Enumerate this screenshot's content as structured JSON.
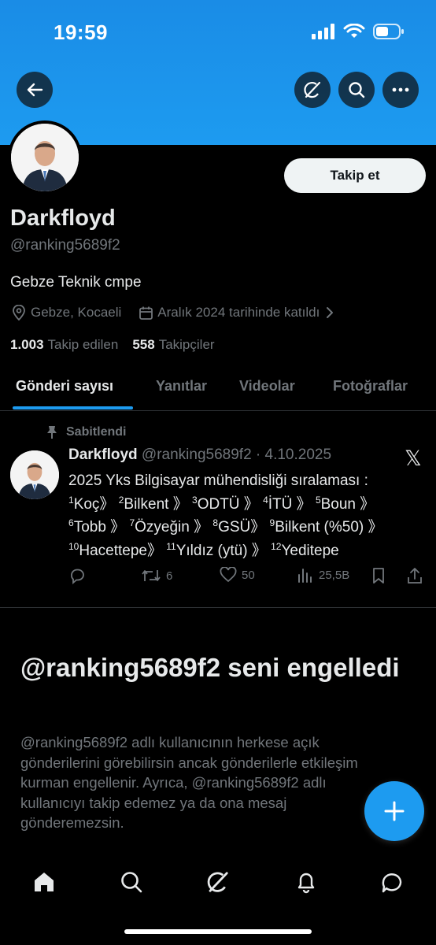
{
  "status_bar": {
    "time": "19:59"
  },
  "header": {
    "back_icon": "arrow-left-icon",
    "grok_icon": "grok-icon",
    "search_icon": "search-icon",
    "more_icon": "more-horizontal-icon"
  },
  "profile": {
    "display_name": "Darkfloyd",
    "handle": "@ranking5689f2",
    "bio": "Gebze Teknik cmpe",
    "location": "Gebze, Kocaeli",
    "joined": "Aralık 2024 tarihinde katıldı",
    "following_count": "1.003",
    "following_label": "Takip edilen",
    "followers_count": "558",
    "followers_label": "Takipçiler",
    "follow_button": "Takip et"
  },
  "tabs": [
    {
      "label": "Gönderi sayısı",
      "active": true
    },
    {
      "label": "Yanıtlar"
    },
    {
      "label": "Videolar"
    },
    {
      "label": "Fotoğraflar"
    }
  ],
  "pinned_tweet": {
    "pinned_label": "Sabitlendi",
    "name": "Darkfloyd",
    "meta": "@ranking5689f2 · 4.10.2025",
    "line1": "2025 Yks Bilgisayar mühendisliği sıralaması :",
    "sup1": "1",
    "t1": "Koç》 ",
    "sup2": "2",
    "t2": "Bilkent 》 ",
    "sup3": "3",
    "t3": "ODTÜ 》 ",
    "sup4": "4",
    "t4": "İTÜ 》 ",
    "sup5": "5",
    "t5": "Boun 》",
    "sup6": "6",
    "t6": "Tobb 》 ",
    "sup7": "7",
    "t7": "Özyeğin 》 ",
    "sup8": "8",
    "t8": "GSÜ》 ",
    "sup9": "9",
    "t9": "Bilkent (%50) 》",
    "sup10": "10",
    "t10": "Hacettepe》 ",
    "sup11": "11",
    "t11": "Yıldız (ytü) 》 ",
    "sup12": "12",
    "t12": "Yeditepe",
    "retweets": "6",
    "likes": "50",
    "views": "25,5B"
  },
  "blocked": {
    "title": "@ranking5689f2 seni engelledi",
    "line1": "@ranking5689f2 adlı kullanıcının herkese açık",
    "line2": "gönderilerini görebilirsin ancak gönderilerle etkileşim",
    "line3": "kurman engellenir. Ayrıca, @ranking5689f2 adlı",
    "line4": "kullanıcıyı takip edemez ya da ona mesaj",
    "line5": "gönderemezsin."
  },
  "colors": {
    "accent": "#1d9bf0",
    "background": "#000000",
    "text_primary": "#e7e9ea",
    "text_secondary": "#71767b"
  },
  "bottom_nav": [
    "home-icon",
    "search-icon",
    "grok-icon",
    "bell-icon",
    "mail-icon"
  ]
}
